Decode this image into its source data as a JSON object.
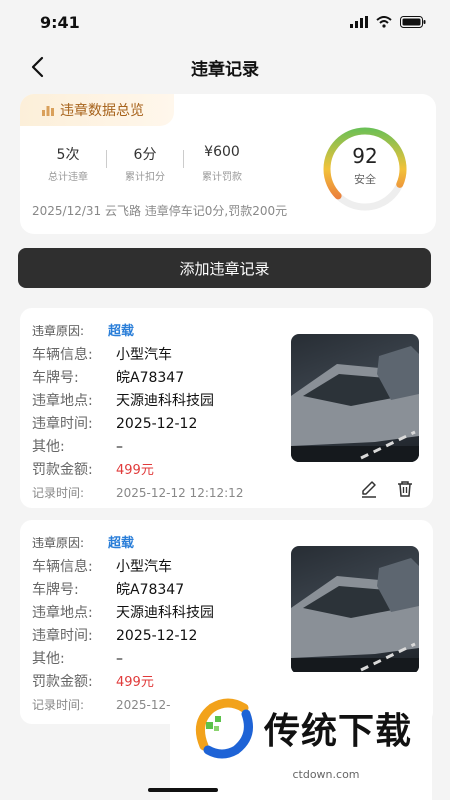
{
  "status_bar": {
    "time": "9:41"
  },
  "nav": {
    "title": "违章记录"
  },
  "summary": {
    "header": "违章数据总览",
    "stats": [
      {
        "value": "5次",
        "label": "总计违章"
      },
      {
        "value": "6分",
        "label": "累计扣分"
      },
      {
        "value": "¥600",
        "label": "累计罚款"
      }
    ],
    "score": "92",
    "score_label": "安全",
    "score_level": 0.92,
    "latest": "2025/12/31 云飞路 违章停车记0分,罚款200元"
  },
  "add_button": "添加违章记录",
  "records": [
    {
      "reason_label": "违章原因:",
      "reason": "超载",
      "vehicle_label": "车辆信息:",
      "vehicle": "小型汽车",
      "plate_label": "车牌号:",
      "plate": "皖A78347",
      "location_label": "违章地点:",
      "location": "天源迪科科技园",
      "time_label": "违章时间:",
      "time": "2025-12-12",
      "other_label": "其他:",
      "other": "–",
      "fine_label": "罚款金额:",
      "fine": "499元",
      "recorded_label": "记录时间:",
      "recorded": "2025-12-12 12:12:12"
    },
    {
      "reason_label": "违章原因:",
      "reason": "超载",
      "vehicle_label": "车辆信息:",
      "vehicle": "小型汽车",
      "plate_label": "车牌号:",
      "plate": "皖A78347",
      "location_label": "违章地点:",
      "location": "天源迪科科技园",
      "time_label": "违章时间:",
      "time": "2025-12-12",
      "other_label": "其他:",
      "other": "–",
      "fine_label": "罚款金额:",
      "fine": "499元",
      "recorded_label": "记录时间:",
      "recorded": "2025-12-"
    }
  ],
  "watermark": {
    "brand": "传统下载",
    "url": "ctdown.com"
  }
}
